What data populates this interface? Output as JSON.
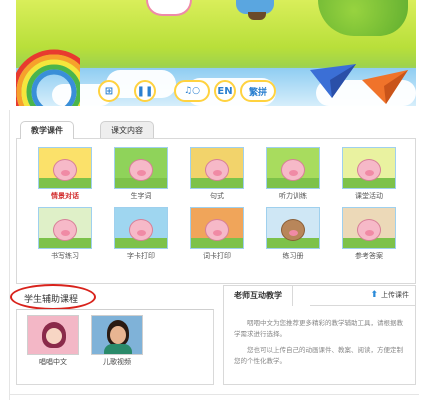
{
  "banner": {
    "controls": [
      "⊞",
      "❚❚",
      "♫○",
      "EN",
      "繁拼"
    ],
    "colors": {
      "sky": "#8fcdf2",
      "grass": "#b8df3a",
      "accent_yellow": "#ffd23f",
      "plane_blue": "#3b6fd6",
      "plane_orange": "#f0732a"
    }
  },
  "courseware": {
    "tabs": [
      {
        "label": "教学课件",
        "active": true
      },
      {
        "label": "课文内容",
        "active": false
      }
    ],
    "items": [
      {
        "label": "情景对话",
        "highlight": true,
        "bg": "#fbe16a"
      },
      {
        "label": "生字词",
        "highlight": false,
        "bg": "#8fd35a"
      },
      {
        "label": "句式",
        "highlight": false,
        "bg": "#f2d36b"
      },
      {
        "label": "听力训练",
        "highlight": false,
        "bg": "#a8dc5e"
      },
      {
        "label": "课堂活动",
        "highlight": false,
        "bg": "#e9f2a0"
      },
      {
        "label": "书写练习",
        "highlight": false,
        "bg": "#dff0c8"
      },
      {
        "label": "字卡打印",
        "highlight": false,
        "bg": "#9fd6f0"
      },
      {
        "label": "词卡打印",
        "highlight": false,
        "bg": "#f0a55a"
      },
      {
        "label": "练习册",
        "highlight": false,
        "bg": "#cfe7f5"
      },
      {
        "label": "参考答案",
        "highlight": false,
        "bg": "#ecd9b8"
      }
    ]
  },
  "student": {
    "heading": "学生辅助课程",
    "items": [
      {
        "label": "唱唱中文",
        "bg": "#f3b7c6"
      },
      {
        "label": "儿歌视频",
        "bg": "#7fb2d8"
      }
    ]
  },
  "teacher": {
    "tab_label": "老师互动教学",
    "upload_label": "上传课件",
    "paragraphs": [
      "咽咽中文为您推荐更多精彩的教学辅助工具，请根据教学需求进行选择。",
      "您也可以上传自己的动画课件、教案、阅读，方便定制您的个性化教学。"
    ]
  }
}
